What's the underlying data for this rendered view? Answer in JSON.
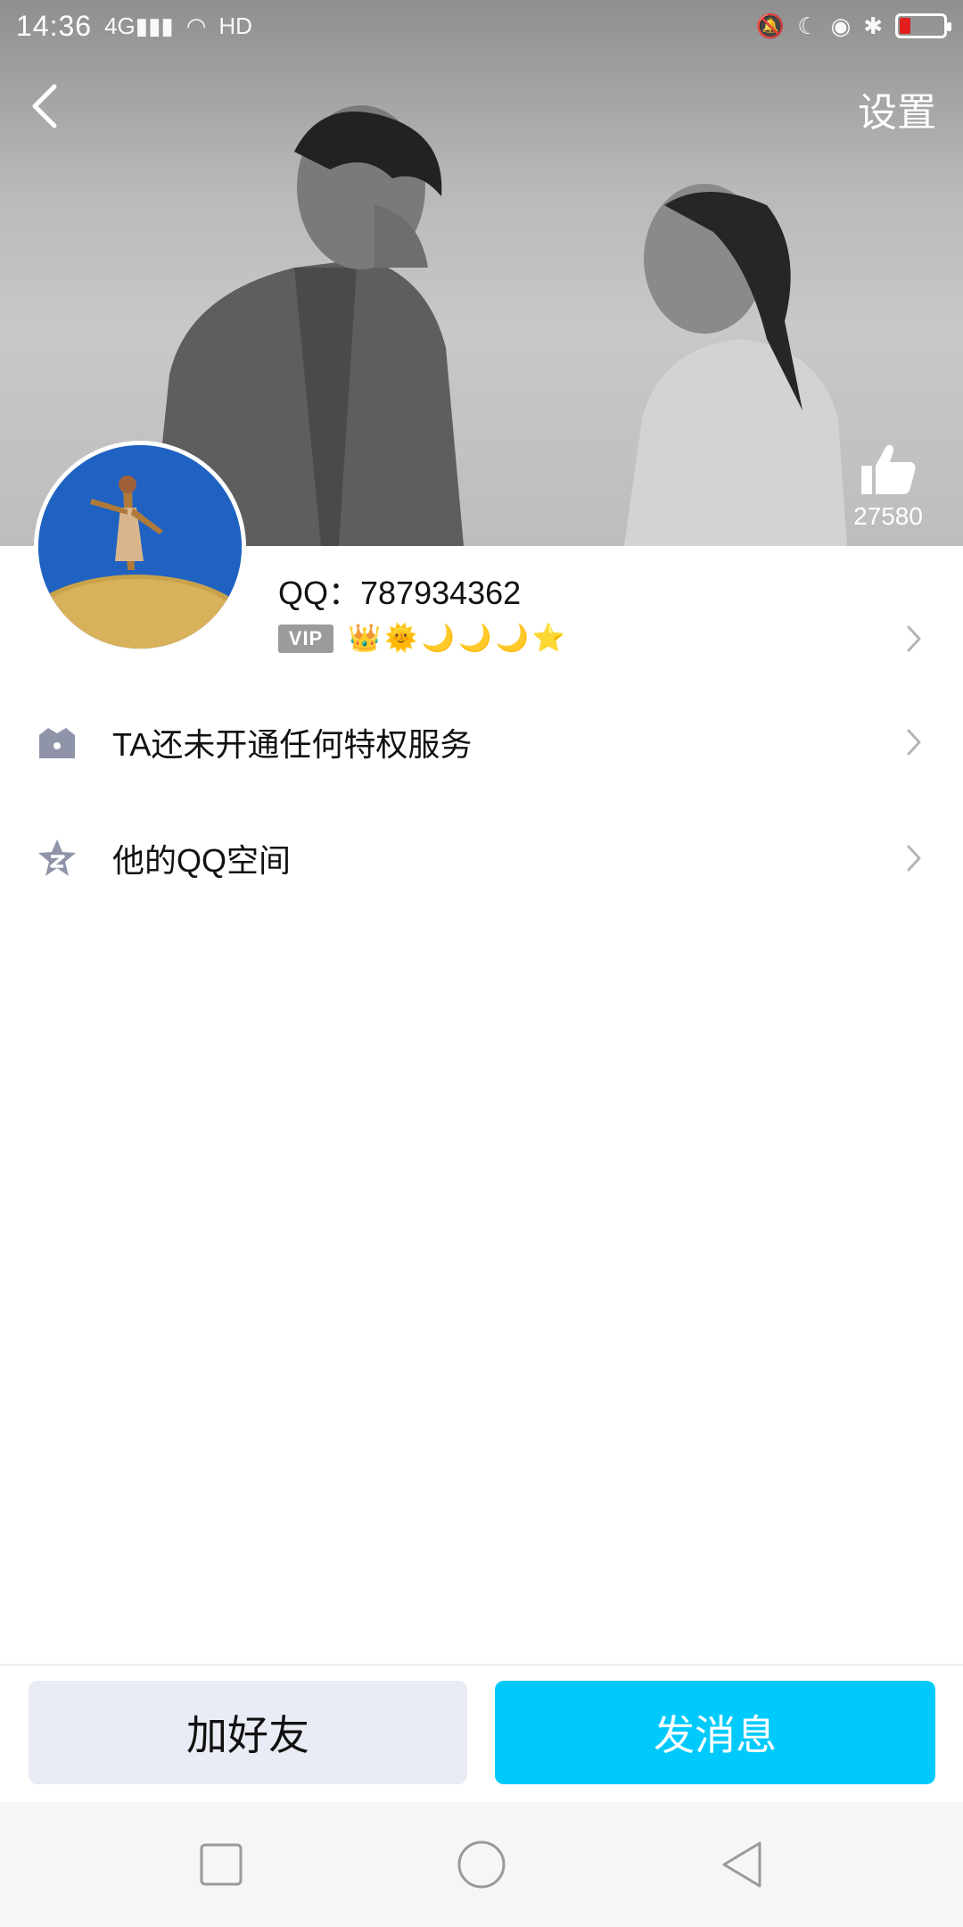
{
  "status_bar": {
    "time": "14:36",
    "network": "4G",
    "hd": "HD"
  },
  "header": {
    "settings_label": "设置",
    "like_count": "27580"
  },
  "profile": {
    "qq_label": "QQ：787934362",
    "vip_label": "VIP",
    "level_icons": [
      "👑",
      "🌞",
      "🌙",
      "🌙",
      "🌙",
      "⭐"
    ]
  },
  "list": {
    "items": [
      {
        "label": "TA还未开通任何特权服务",
        "icon": "privilege-icon"
      },
      {
        "label": "他的QQ空间",
        "icon": "qzone-star-icon"
      }
    ]
  },
  "actions": {
    "add_friend": "加好友",
    "send_message": "发消息"
  },
  "colors": {
    "accent": "#00cafc",
    "secondary_button": "#e9ecf5",
    "battery_low": "#e21e1e"
  }
}
